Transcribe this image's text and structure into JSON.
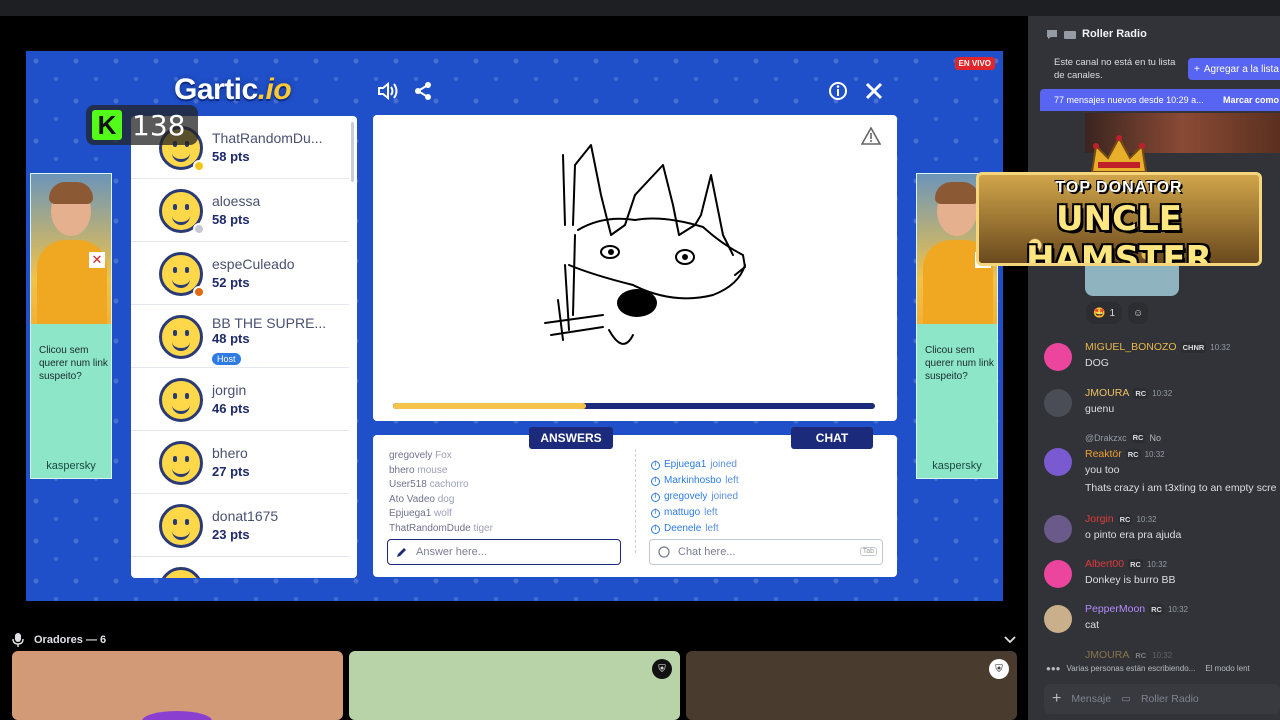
{
  "game": {
    "live_badge": "EN VIVO",
    "logo_main": "Gartic",
    "logo_suffix": ".io",
    "kick_count": "138",
    "kick_logo": "K",
    "players": [
      {
        "name": "ThatRandomDu...",
        "pts": "58 pts",
        "status_color": "#f5c518"
      },
      {
        "name": "aloessa",
        "pts": "58 pts",
        "status_color": "#c6c9d3"
      },
      {
        "name": "espeCuleado",
        "pts": "52 pts",
        "status_color": "#e16a12"
      },
      {
        "name": "BB THE SUPRE...",
        "pts": "48 pts",
        "host": "Host"
      },
      {
        "name": "jorgin",
        "pts": "46 pts"
      },
      {
        "name": "bhero",
        "pts": "27 pts"
      },
      {
        "name": "donat1675",
        "pts": "23 pts"
      }
    ],
    "progress": 0.4,
    "answers_label": "ANSWERS",
    "chat_label": "CHAT",
    "answers": [
      {
        "user": "gregovely",
        "guess": "Fox"
      },
      {
        "user": "bhero",
        "guess": "mouse"
      },
      {
        "user": "User518",
        "guess": "cachorro"
      },
      {
        "user": "Ato Vadeo",
        "guess": "dog"
      },
      {
        "user": "Epjuega1",
        "guess": "wolf"
      },
      {
        "user": "ThatRandomDude",
        "guess": "tiger"
      }
    ],
    "chat": [
      {
        "user": "Epjuega1",
        "action": "joined"
      },
      {
        "user": "Markinhosbo",
        "action": "left"
      },
      {
        "user": "gregovely",
        "action": "joined"
      },
      {
        "user": "mattugo",
        "action": "left"
      },
      {
        "user": "Deenele",
        "action": "left"
      }
    ],
    "answer_placeholder": "Answer here...",
    "chat_placeholder": "Chat here...",
    "tab_key": "Tab"
  },
  "ad": {
    "text": "Clicou sem querer num link suspeito?",
    "brand": "kaspersky",
    "close": "✕"
  },
  "donator": {
    "top": "TOP DONATOR",
    "name": "UNCLE HAMSTER"
  },
  "speakers": {
    "label": "Oradores — 6"
  },
  "sidebar": {
    "channel": "Roller Radio",
    "notice": "Este canal no está en tu lista de canales.",
    "add_button": "Agregar a la lista",
    "new_messages": "77 mensajes nuevos desde 10:29 a...",
    "mark_read": "Marcar como",
    "reaction_count": "1",
    "messages": [
      {
        "user": "MIGUEL_BONOZO",
        "user_color": "#e8b84a",
        "tag": "CHNR",
        "time": "10:32",
        "text": "DOG",
        "avatar": "#eb459e"
      },
      {
        "user": "JMOURA",
        "user_color": "#f0c060",
        "tag": "RC",
        "time": "10:32",
        "text": "guenu",
        "avatar": "#4a4d55"
      },
      {
        "user": "Reaktör",
        "user_color": "#f0a030",
        "tag": "RC",
        "time": "10:32",
        "text": "you too",
        "text2": "Thats crazy i am t3xting to an empty scre",
        "avatar": "#7a5ad0",
        "reply": "@Drakzxc",
        "reply_tag": "RC",
        "reply_text": "No"
      },
      {
        "user": "Jorgin",
        "user_color": "#e03a3a",
        "tag": "RC",
        "time": "10:32",
        "text": "o pinto era pra ajuda",
        "avatar": "#6a5a8a"
      },
      {
        "user": "Albert00",
        "user_color": "#e03a3a",
        "tag": "RC",
        "time": "10:32",
        "text": "Donkey is burro BB",
        "avatar": "#eb459e"
      },
      {
        "user": "PepperMoon",
        "user_color": "#b58cff",
        "tag": "RC",
        "time": "10:32",
        "text": "cat",
        "avatar": "#c9b08a"
      },
      {
        "user": "JMOURA",
        "user_color": "#f0c060",
        "tag": "RC",
        "time": "10:32",
        "text": "",
        "avatar": "#4a4d55"
      }
    ],
    "typing": "Varias personas están escribiendo...",
    "slow_mode": "El modo lent",
    "composer_placeholder": "Mensaje",
    "composer_channel": "Roller Radio"
  }
}
